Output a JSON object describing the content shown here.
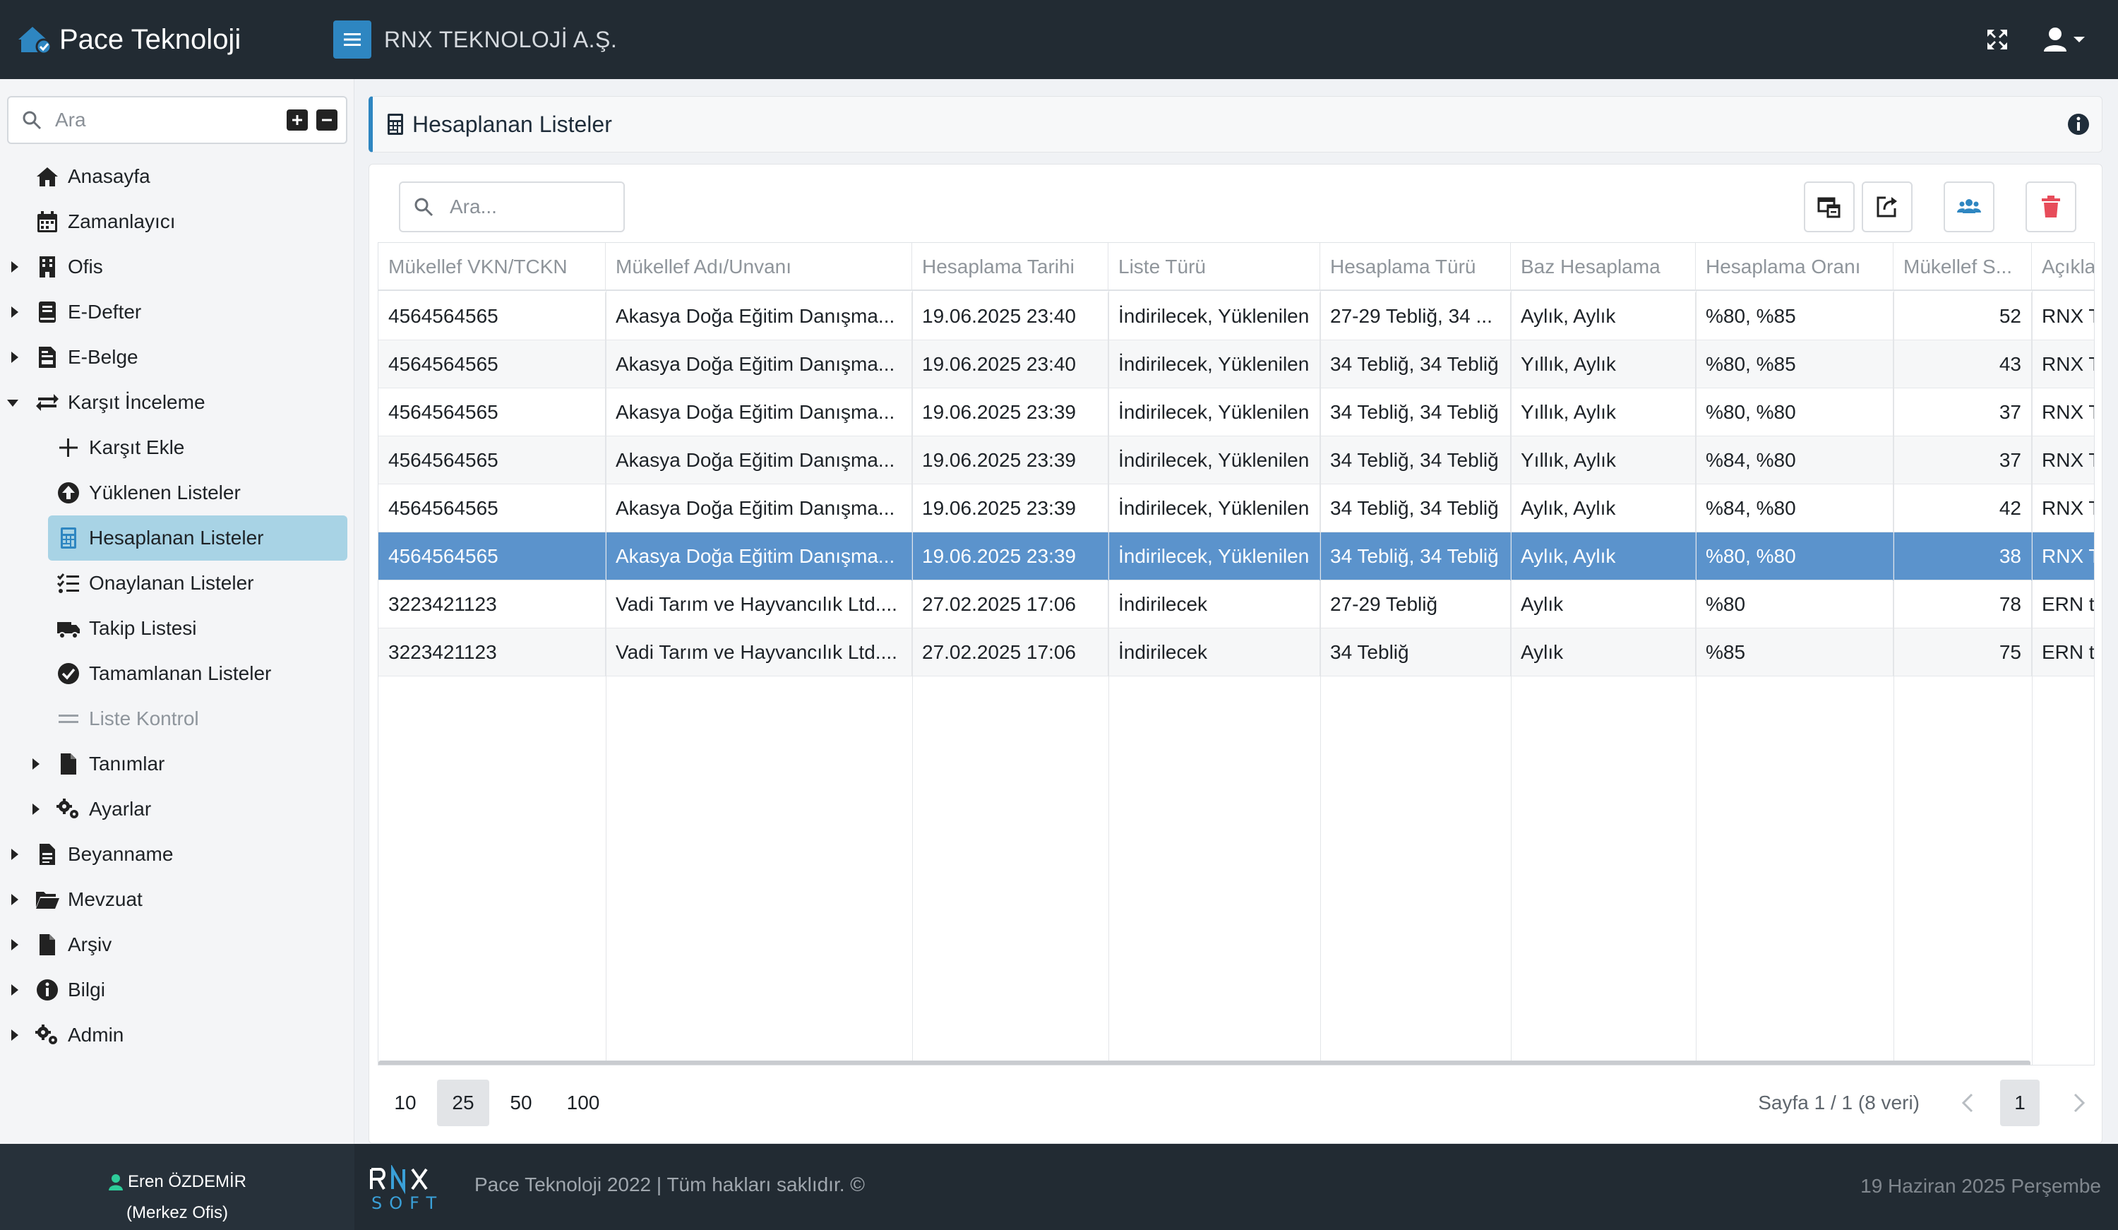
{
  "topbar": {
    "brand": "Pace Teknoloji",
    "company": "RNX TEKNOLOJİ A.Ş."
  },
  "sidebar": {
    "search_placeholder": "Ara",
    "items": [
      {
        "label": "Anasayfa",
        "icon": "home-icon"
      },
      {
        "label": "Zamanlayıcı",
        "icon": "calendar-icon"
      },
      {
        "label": "Ofis",
        "icon": "building-icon"
      },
      {
        "label": "E-Defter",
        "icon": "book-icon"
      },
      {
        "label": "E-Belge",
        "icon": "invoice-icon"
      },
      {
        "label": "Karşıt İnceleme",
        "icon": "exchange-icon"
      },
      {
        "label": "Karşıt Ekle",
        "icon": "plus-icon"
      },
      {
        "label": "Yüklenen Listeler",
        "icon": "upload-circle-icon"
      },
      {
        "label": "Hesaplanan Listeler",
        "icon": "calculator-icon"
      },
      {
        "label": "Onaylanan Listeler",
        "icon": "checklist-icon"
      },
      {
        "label": "Takip Listesi",
        "icon": "truck-icon"
      },
      {
        "label": "Tamamlanan Listeler",
        "icon": "check-circle-icon"
      },
      {
        "label": "Liste Kontrol",
        "icon": "equals-icon"
      },
      {
        "label": "Tanımlar",
        "icon": "file-icon"
      },
      {
        "label": "Ayarlar",
        "icon": "gears-icon"
      },
      {
        "label": "Beyanname",
        "icon": "file-lines-icon"
      },
      {
        "label": "Mevzuat",
        "icon": "folder-open-icon"
      },
      {
        "label": "Arşiv",
        "icon": "file-icon"
      },
      {
        "label": "Bilgi",
        "icon": "info-circle-icon"
      },
      {
        "label": "Admin",
        "icon": "gears-icon"
      }
    ]
  },
  "page": {
    "title": "Hesaplanan Listeler",
    "search_placeholder": "Ara..."
  },
  "table": {
    "columns": [
      "Mükellef VKN/TCKN",
      "Mükellef Adı/Unvanı",
      "Hesaplama Tarihi",
      "Liste Türü",
      "Hesaplama Türü",
      "Baz Hesaplama",
      "Hesaplama Oranı",
      "Mükellef S...",
      "Açıkla"
    ],
    "rows": [
      [
        "4564564565",
        "Akasya Doğa Eğitim Danışma...",
        "19.06.2025 23:40",
        "İndirilecek, Yüklenilen",
        "27-29 Tebliğ, 34 ...",
        "Aylık, Aylık",
        "%80, %85",
        "52",
        "RNX T"
      ],
      [
        "4564564565",
        "Akasya Doğa Eğitim Danışma...",
        "19.06.2025 23:40",
        "İndirilecek, Yüklenilen",
        "34 Tebliğ, 34 Tebliğ",
        "Yıllık, Aylık",
        "%80, %85",
        "43",
        "RNX T"
      ],
      [
        "4564564565",
        "Akasya Doğa Eğitim Danışma...",
        "19.06.2025 23:39",
        "İndirilecek, Yüklenilen",
        "34 Tebliğ, 34 Tebliğ",
        "Yıllık, Aylık",
        "%80, %80",
        "37",
        "RNX T"
      ],
      [
        "4564564565",
        "Akasya Doğa Eğitim Danışma...",
        "19.06.2025 23:39",
        "İndirilecek, Yüklenilen",
        "34 Tebliğ, 34 Tebliğ",
        "Yıllık, Aylık",
        "%84, %80",
        "37",
        "RNX T"
      ],
      [
        "4564564565",
        "Akasya Doğa Eğitim Danışma...",
        "19.06.2025 23:39",
        "İndirilecek, Yüklenilen",
        "34 Tebliğ, 34 Tebliğ",
        "Aylık, Aylık",
        "%84, %80",
        "42",
        "RNX T"
      ],
      [
        "4564564565",
        "Akasya Doğa Eğitim Danışma...",
        "19.06.2025 23:39",
        "İndirilecek, Yüklenilen",
        "34 Tebliğ, 34 Tebliğ",
        "Aylık, Aylık",
        "%80, %80",
        "38",
        "RNX T"
      ],
      [
        "3223421123",
        "Vadi Tarım ve Hayvancılık Ltd....",
        "27.02.2025 17:06",
        "İndirilecek",
        "27-29 Tebliğ",
        "Aylık",
        "%80",
        "78",
        "ERN t"
      ],
      [
        "3223421123",
        "Vadi Tarım ve Hayvancılık Ltd....",
        "27.02.2025 17:06",
        "İndirilecek",
        "34 Tebliğ",
        "Aylık",
        "%85",
        "75",
        "ERN t"
      ]
    ],
    "selected_row": 5
  },
  "pager": {
    "sizes": [
      "10",
      "25",
      "50",
      "100"
    ],
    "active_size": "25",
    "info": "Sayfa 1 / 1 (8 veri)",
    "current_page": "1"
  },
  "footer": {
    "user_name": "Eren ÖZDEMİR",
    "user_office": "(Merkez Ofis)",
    "copyright": "Pace Teknoloji 2022 | Tüm hakları saklıdır. ©",
    "date": "19 Haziran 2025 Perşembe"
  },
  "colors": {
    "topbar": "#222b33",
    "accent": "#2e86c1",
    "selected_row": "#5b93cc",
    "active_nav": "#a8d3e5",
    "delete": "#e74c5a",
    "users_icon": "#2e86c1"
  }
}
